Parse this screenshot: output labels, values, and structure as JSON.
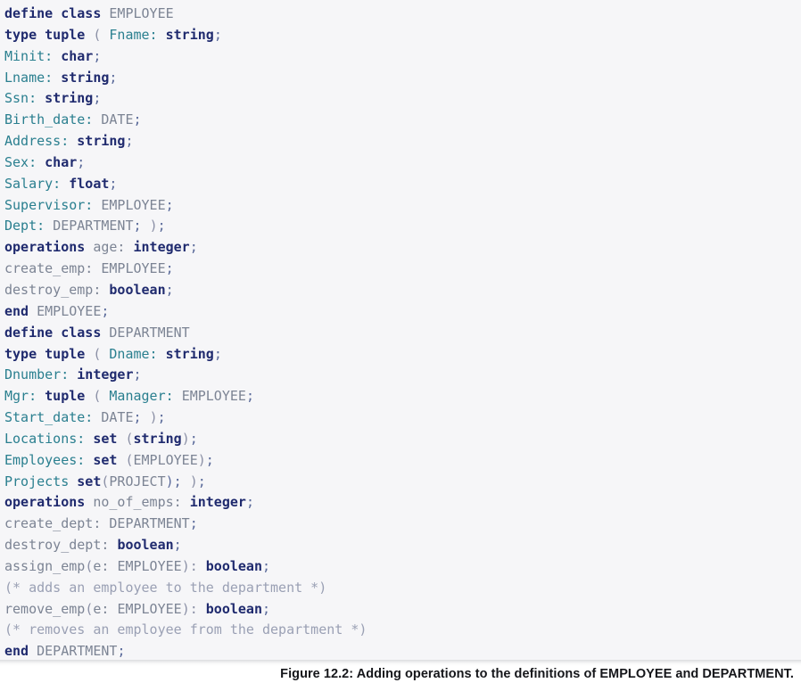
{
  "figure": {
    "caption": "Figure 12.2: Adding operations to the definitions of EMPLOYEE and DEPARTMENT.",
    "background_color": "#f6f6f8",
    "page_color": "#ffffff"
  },
  "colors": {
    "keyword": "#1f2a6e",
    "type": "#1f2a6e",
    "attribute": "#2a7f8f",
    "identifier": "#7c8494",
    "comment": "#9aa0b4",
    "punctuation": "#5a6a9a",
    "caption_text": "#15161a"
  },
  "code": {
    "language": "ODL",
    "line_count": 31,
    "lines": [
      "define class EMPLOYEE",
      "type tuple ( Fname: string;",
      "Minit: char;",
      "Lname: string;",
      "Ssn: string;",
      "Birth_date: DATE;",
      "Address: string;",
      "Sex: char;",
      "Salary: float;",
      "Supervisor: EMPLOYEE;",
      "Dept: DEPARTMENT; );",
      "operations age: integer;",
      "create_emp: EMPLOYEE;",
      "destroy_emp: boolean;",
      "end EMPLOYEE;",
      "define class DEPARTMENT",
      "type tuple ( Dname: string;",
      "Dnumber: integer;",
      "Mgr: tuple ( Manager: EMPLOYEE;",
      "Start_date: DATE; );",
      "Locations: set (string);",
      "Employees: set (EMPLOYEE);",
      "Projects set(PROJECT); );",
      "operations no_of_emps: integer;",
      "create_dept: DEPARTMENT;",
      "destroy_dept: boolean;",
      "assign_emp(e: EMPLOYEE): boolean;",
      "(* adds an employee to the department *)",
      "remove_emp(e: EMPLOYEE): boolean;",
      "(* removes an employee from the department *)",
      "end DEPARTMENT;"
    ],
    "tokens": [
      [
        [
          "define ",
          "kw"
        ],
        [
          "class ",
          "kw"
        ],
        [
          "EMPLOYEE",
          "id"
        ]
      ],
      [
        [
          "type ",
          "kw"
        ],
        [
          "tuple ",
          "kw"
        ],
        [
          "( ",
          "punc"
        ],
        [
          "Fname: ",
          "attr"
        ],
        [
          "string",
          "ty"
        ],
        [
          ";",
          "op"
        ]
      ],
      [
        [
          "Minit: ",
          "attr"
        ],
        [
          "char",
          "ty"
        ],
        [
          ";",
          "op"
        ]
      ],
      [
        [
          "Lname: ",
          "attr"
        ],
        [
          "string",
          "ty"
        ],
        [
          ";",
          "op"
        ]
      ],
      [
        [
          "Ssn: ",
          "attr"
        ],
        [
          "string",
          "ty"
        ],
        [
          ";",
          "op"
        ]
      ],
      [
        [
          "Birth_date: ",
          "attr"
        ],
        [
          "DATE",
          "id"
        ],
        [
          ";",
          "op"
        ]
      ],
      [
        [
          "Address: ",
          "attr"
        ],
        [
          "string",
          "ty"
        ],
        [
          ";",
          "op"
        ]
      ],
      [
        [
          "Sex: ",
          "attr"
        ],
        [
          "char",
          "ty"
        ],
        [
          ";",
          "op"
        ]
      ],
      [
        [
          "Salary: ",
          "attr"
        ],
        [
          "float",
          "ty"
        ],
        [
          ";",
          "op"
        ]
      ],
      [
        [
          "Supervisor: ",
          "attr"
        ],
        [
          "EMPLOYEE",
          "id"
        ],
        [
          ";",
          "op"
        ]
      ],
      [
        [
          "Dept: ",
          "attr"
        ],
        [
          "DEPARTMENT",
          "id"
        ],
        [
          "; ",
          "op"
        ],
        [
          ")",
          "punc"
        ],
        [
          ";",
          "op"
        ]
      ],
      [
        [
          "operations ",
          "kw"
        ],
        [
          "age: ",
          "plain"
        ],
        [
          "integer",
          "ty"
        ],
        [
          ";",
          "op"
        ]
      ],
      [
        [
          "create_emp: ",
          "plain"
        ],
        [
          "EMPLOYEE",
          "id"
        ],
        [
          ";",
          "op"
        ]
      ],
      [
        [
          "destroy_emp: ",
          "plain"
        ],
        [
          "boolean",
          "ty"
        ],
        [
          ";",
          "op"
        ]
      ],
      [
        [
          "end ",
          "kw"
        ],
        [
          "EMPLOYEE",
          "id"
        ],
        [
          ";",
          "op"
        ]
      ],
      [
        [
          "define ",
          "kw"
        ],
        [
          "class ",
          "kw"
        ],
        [
          "DEPARTMENT",
          "id"
        ]
      ],
      [
        [
          "type ",
          "kw"
        ],
        [
          "tuple ",
          "kw"
        ],
        [
          "( ",
          "punc"
        ],
        [
          "Dname: ",
          "attr"
        ],
        [
          "string",
          "ty"
        ],
        [
          ";",
          "op"
        ]
      ],
      [
        [
          "Dnumber: ",
          "attr"
        ],
        [
          "integer",
          "ty"
        ],
        [
          ";",
          "op"
        ]
      ],
      [
        [
          "Mgr: ",
          "attr"
        ],
        [
          "tuple ",
          "kw"
        ],
        [
          "( ",
          "punc"
        ],
        [
          "Manager: ",
          "attr"
        ],
        [
          "EMPLOYEE",
          "id"
        ],
        [
          ";",
          "op"
        ]
      ],
      [
        [
          "Start_date: ",
          "attr"
        ],
        [
          "DATE",
          "id"
        ],
        [
          "; ",
          "op"
        ],
        [
          ")",
          "punc"
        ],
        [
          ";",
          "op"
        ]
      ],
      [
        [
          "Locations: ",
          "attr"
        ],
        [
          "set ",
          "kw"
        ],
        [
          "(",
          "punc"
        ],
        [
          "string",
          "ty"
        ],
        [
          ")",
          "punc"
        ],
        [
          ";",
          "op"
        ]
      ],
      [
        [
          "Employees: ",
          "attr"
        ],
        [
          "set ",
          "kw"
        ],
        [
          "(",
          "punc"
        ],
        [
          "EMPLOYEE",
          "id"
        ],
        [
          ")",
          "punc"
        ],
        [
          ";",
          "op"
        ]
      ],
      [
        [
          "Projects ",
          "attr"
        ],
        [
          "set",
          "kw"
        ],
        [
          "(",
          "punc"
        ],
        [
          "PROJECT",
          "id"
        ],
        [
          "); ",
          "op"
        ],
        [
          ")",
          "punc"
        ],
        [
          ";",
          "op"
        ]
      ],
      [
        [
          "operations ",
          "kw"
        ],
        [
          "no_of_emps: ",
          "plain"
        ],
        [
          "integer",
          "ty"
        ],
        [
          ";",
          "op"
        ]
      ],
      [
        [
          "create_dept: ",
          "plain"
        ],
        [
          "DEPARTMENT",
          "id"
        ],
        [
          ";",
          "op"
        ]
      ],
      [
        [
          "destroy_dept: ",
          "plain"
        ],
        [
          "boolean",
          "ty"
        ],
        [
          ";",
          "op"
        ]
      ],
      [
        [
          "assign_emp",
          "plain"
        ],
        [
          "(",
          "punc"
        ],
        [
          "e: ",
          "plain"
        ],
        [
          "EMPLOYEE",
          "id"
        ],
        [
          "): ",
          "punc"
        ],
        [
          "boolean",
          "ty"
        ],
        [
          ";",
          "op"
        ]
      ],
      [
        [
          "(* adds an employee to the department *)",
          "cmt"
        ]
      ],
      [
        [
          "remove_emp",
          "plain"
        ],
        [
          "(",
          "punc"
        ],
        [
          "e: ",
          "plain"
        ],
        [
          "EMPLOYEE",
          "id"
        ],
        [
          "): ",
          "punc"
        ],
        [
          "boolean",
          "ty"
        ],
        [
          ";",
          "op"
        ]
      ],
      [
        [
          "(* removes an employee from the department *)",
          "cmt"
        ]
      ],
      [
        [
          "end ",
          "kw"
        ],
        [
          "DEPARTMENT",
          "id"
        ],
        [
          ";",
          "op"
        ]
      ]
    ]
  }
}
